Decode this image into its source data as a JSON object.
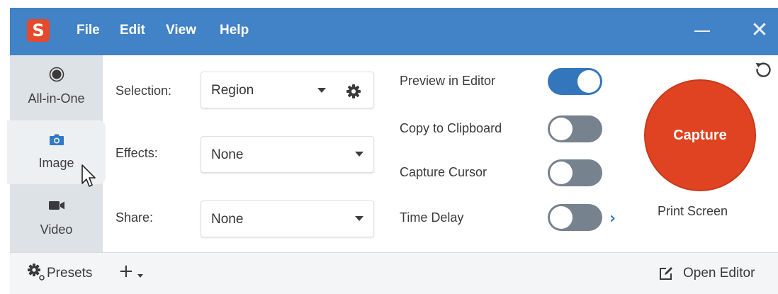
{
  "app": {
    "logo_letter": "S"
  },
  "menu": {
    "items": [
      "File",
      "Edit",
      "View",
      "Help"
    ]
  },
  "window_controls": {
    "close_glyph": "✕"
  },
  "modes": [
    {
      "label": "All-in-One",
      "icon": "radio-record-icon",
      "active": false
    },
    {
      "label": "Image",
      "icon": "camera-icon",
      "active": true
    },
    {
      "label": "Video",
      "icon": "video-camera-icon",
      "active": false
    }
  ],
  "fields": {
    "selection": {
      "label": "Selection:",
      "value": "Region"
    },
    "effects": {
      "label": "Effects:",
      "value": "None"
    },
    "share": {
      "label": "Share:",
      "value": "None"
    }
  },
  "toggles": [
    {
      "label": "Preview in Editor",
      "on": true
    },
    {
      "label": "Copy to Clipboard",
      "on": false
    },
    {
      "label": "Capture Cursor",
      "on": false
    },
    {
      "label": "Time Delay",
      "on": false
    }
  ],
  "capture": {
    "label": "Capture",
    "hotkey": "Print Screen"
  },
  "bottom": {
    "presets_label": "Presets",
    "add_glyph": "+",
    "open_editor_label": "Open Editor"
  },
  "colors": {
    "titlebar": "#4282c6",
    "accent": "#3476bb",
    "capture": "#e04321",
    "logo": "#e44a2b"
  }
}
